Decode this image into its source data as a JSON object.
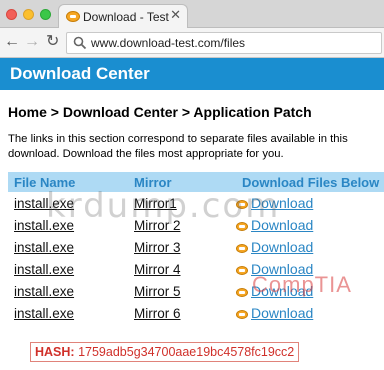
{
  "browser": {
    "tab_title": "Download - Test",
    "tab_close": "✕",
    "address": "www.download-test.com/files",
    "nav": {
      "back": "←",
      "forward": "→",
      "reload": "↻"
    }
  },
  "page": {
    "header_title": "Download Center",
    "breadcrumb": "Home > Download Center > Application Patch",
    "description": "The links in this section correspond to separate files available in this download. Download the files most appropriate for you.",
    "table": {
      "headers": [
        "File Name",
        "Mirror",
        "Download Files Below"
      ],
      "rows": [
        {
          "file": "install.exe",
          "mirror": "Mirror1",
          "download": "Download"
        },
        {
          "file": "install.exe",
          "mirror": "Mirror 2",
          "download": "Download"
        },
        {
          "file": "install.exe",
          "mirror": "Mirror 3",
          "download": "Download"
        },
        {
          "file": "install.exe",
          "mirror": "Mirror 4",
          "download": "Download"
        },
        {
          "file": "install.exe",
          "mirror": "Mirror 5",
          "download": "Download"
        },
        {
          "file": "install.exe",
          "mirror": "Mirror 6",
          "download": "Download"
        }
      ]
    },
    "hash": {
      "label": "HASH:",
      "value": "1759adb5g34700aae19bc4578fc19cc2"
    }
  },
  "watermarks": {
    "krdump": "krdump.com",
    "comptia": "CompTIA"
  },
  "colors": {
    "header_band": "#1a8ed0",
    "table_header_bg": "#aedaf4",
    "link": "#2a86c4",
    "hash_red": "#d0302a"
  }
}
